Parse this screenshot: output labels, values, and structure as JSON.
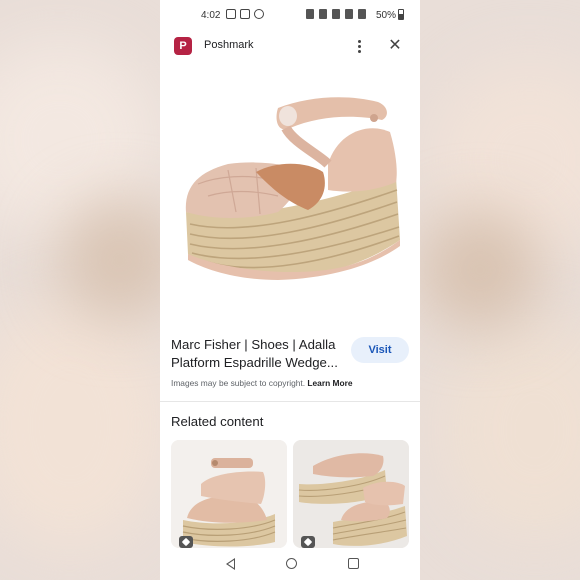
{
  "status_bar": {
    "time": "4:02",
    "battery": "50%"
  },
  "header": {
    "site_name": "Poshmark",
    "favicon_glyph": "P"
  },
  "product": {
    "title": "Marc Fisher | Shoes | Adalla Platform Espadrille Wedge...",
    "visit_label": "Visit",
    "copyright_text": "Images may be subject to copyright.",
    "learn_more": "Learn More"
  },
  "related": {
    "title": "Related content"
  },
  "colors": {
    "brand": "#b52344",
    "visit_bg": "#e8f0fb",
    "visit_text": "#1a56b8",
    "shoe_suede": "#e6c0ac",
    "jute": "#d9c39c"
  },
  "icons": {
    "more": "more-vert-icon",
    "close": "close-icon",
    "back": "back-icon",
    "home": "home-icon",
    "recents": "recents-icon"
  }
}
